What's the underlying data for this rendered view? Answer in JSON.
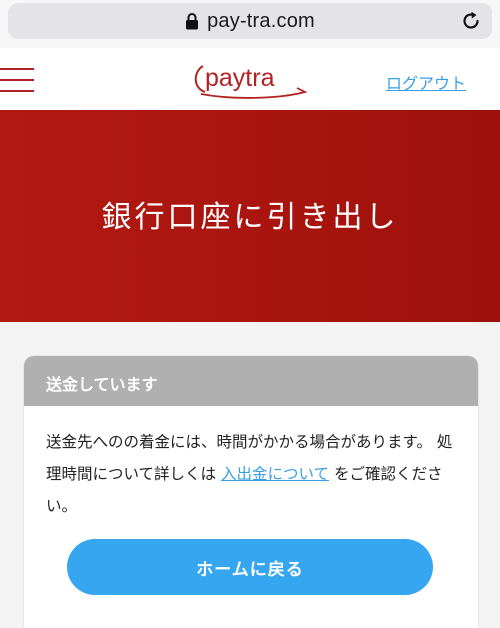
{
  "browser": {
    "url": "pay-tra.com",
    "lock_icon": "lock-icon",
    "reload_icon": "reload-icon"
  },
  "header": {
    "menu_icon": "hamburger-menu-icon",
    "logo_text": "paytra",
    "logout_label": "ログアウト",
    "brand_color": "#b32222",
    "link_color": "#3aa0e6"
  },
  "hero": {
    "title": "銀行口座に引き出し",
    "background_color": "#aa150e"
  },
  "card": {
    "header_title": "送金しています",
    "message_part1": "送金先へのの着金には、時間がかかる場合があります。 処理時間について詳しくは ",
    "message_link": "入出金について",
    "message_part2": " をご確認ください。",
    "home_button_label": "ホームに戻る",
    "button_color": "#37a6f0"
  }
}
